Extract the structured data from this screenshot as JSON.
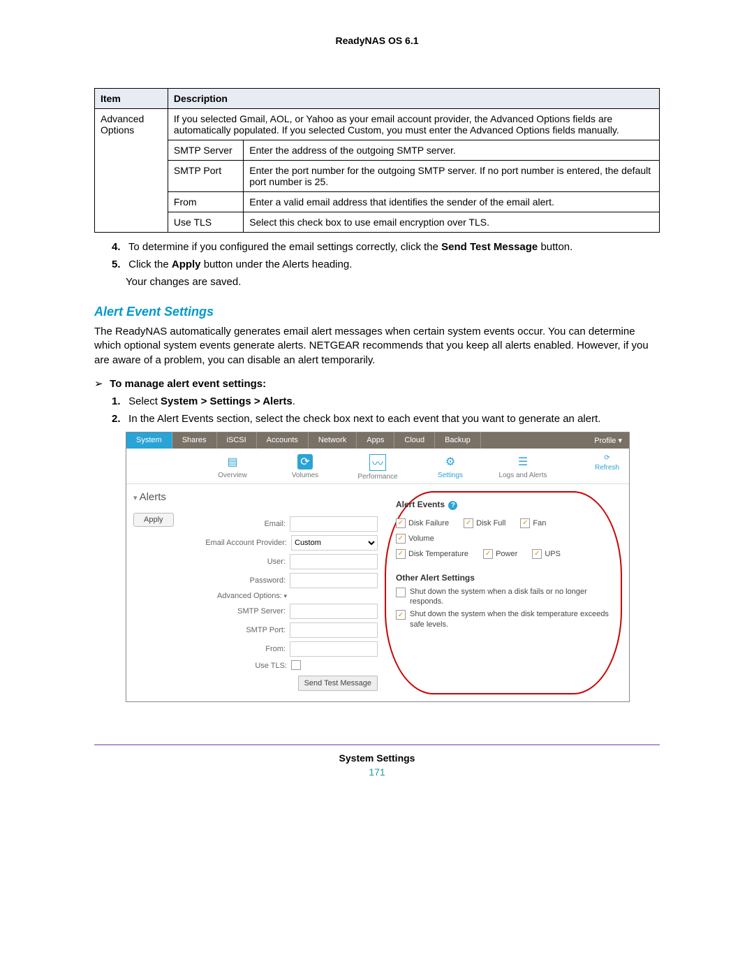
{
  "header": {
    "product": "ReadyNAS OS 6.1"
  },
  "table": {
    "head": {
      "item": "Item",
      "desc": "Description"
    },
    "row0": {
      "item": "Advanced Options",
      "desc": "If you selected Gmail, AOL, or Yahoo as your email account provider, the Advanced Options fields are automatically populated. If you selected Custom, you must enter the Advanced Options fields manually."
    },
    "rows": {
      "smtp_server": {
        "k": "SMTP Server",
        "v": "Enter the address of the outgoing SMTP server."
      },
      "smtp_port": {
        "k": "SMTP Port",
        "v": "Enter the port number for the outgoing SMTP server. If no port number is entered, the default port number is 25."
      },
      "from": {
        "k": "From",
        "v": "Enter a valid email address that identifies the sender of the email alert."
      },
      "use_tls": {
        "k": "Use TLS",
        "v": "Select this check box to use email encryption over TLS."
      }
    }
  },
  "steps_a": {
    "s4_pre": "To determine if you configured the email settings correctly, click the ",
    "s4_b": "Send Test Message",
    "s4_post": " button.",
    "s5_pre": "Click the ",
    "s5_b": "Apply",
    "s5_post": " button under the Alerts heading.",
    "s5_note": "Your changes are saved."
  },
  "section": {
    "title": "Alert Event Settings",
    "para": "The ReadyNAS automatically generates email alert messages when certain system events occur. You can determine which optional system events generate alerts. NETGEAR recommends that you keep all alerts enabled. However, if you are aware of a problem, you can disable an alert temporarily."
  },
  "procedure": {
    "lead": "To manage alert event settings:",
    "s1_pre": "Select ",
    "s1_b": "System > Settings > Alerts",
    "s1_post": ".",
    "s2": "In the Alert Events section, select the check box next to each event that you want to generate an alert."
  },
  "shot": {
    "tabs": {
      "system": "System",
      "shares": "Shares",
      "iscsi": "iSCSI",
      "accounts": "Accounts",
      "network": "Network",
      "apps": "Apps",
      "cloud": "Cloud",
      "backup": "Backup",
      "profile": "Profile ▾"
    },
    "iconbar": {
      "overview": "Overview",
      "volumes": "Volumes",
      "performance": "Performance",
      "settings": "Settings",
      "logs": "Logs and Alerts",
      "refresh": "Refresh"
    },
    "left": {
      "heading": "Alerts",
      "apply": "Apply",
      "labels": {
        "email": "Email:",
        "provider": "Email Account Provider:",
        "user": "User:",
        "password": "Password:",
        "adv": "Advanced Options:",
        "smtp_server": "SMTP Server:",
        "smtp_port": "SMTP Port:",
        "from": "From:",
        "tls": "Use TLS:"
      },
      "provider_value": "Custom",
      "send_test": "Send Test Message"
    },
    "right": {
      "heading": "Alert Events",
      "events": {
        "disk_failure": "Disk Failure",
        "disk_full": "Disk Full",
        "fan": "Fan",
        "volume": "Volume",
        "disk_temp": "Disk Temperature",
        "power": "Power",
        "ups": "UPS"
      },
      "other_heading": "Other Alert Settings",
      "other1": "Shut down the system when a disk fails or no longer responds.",
      "other2": "Shut down the system when the disk temperature exceeds safe levels."
    }
  },
  "footer": {
    "label": "System Settings",
    "page": "171"
  }
}
